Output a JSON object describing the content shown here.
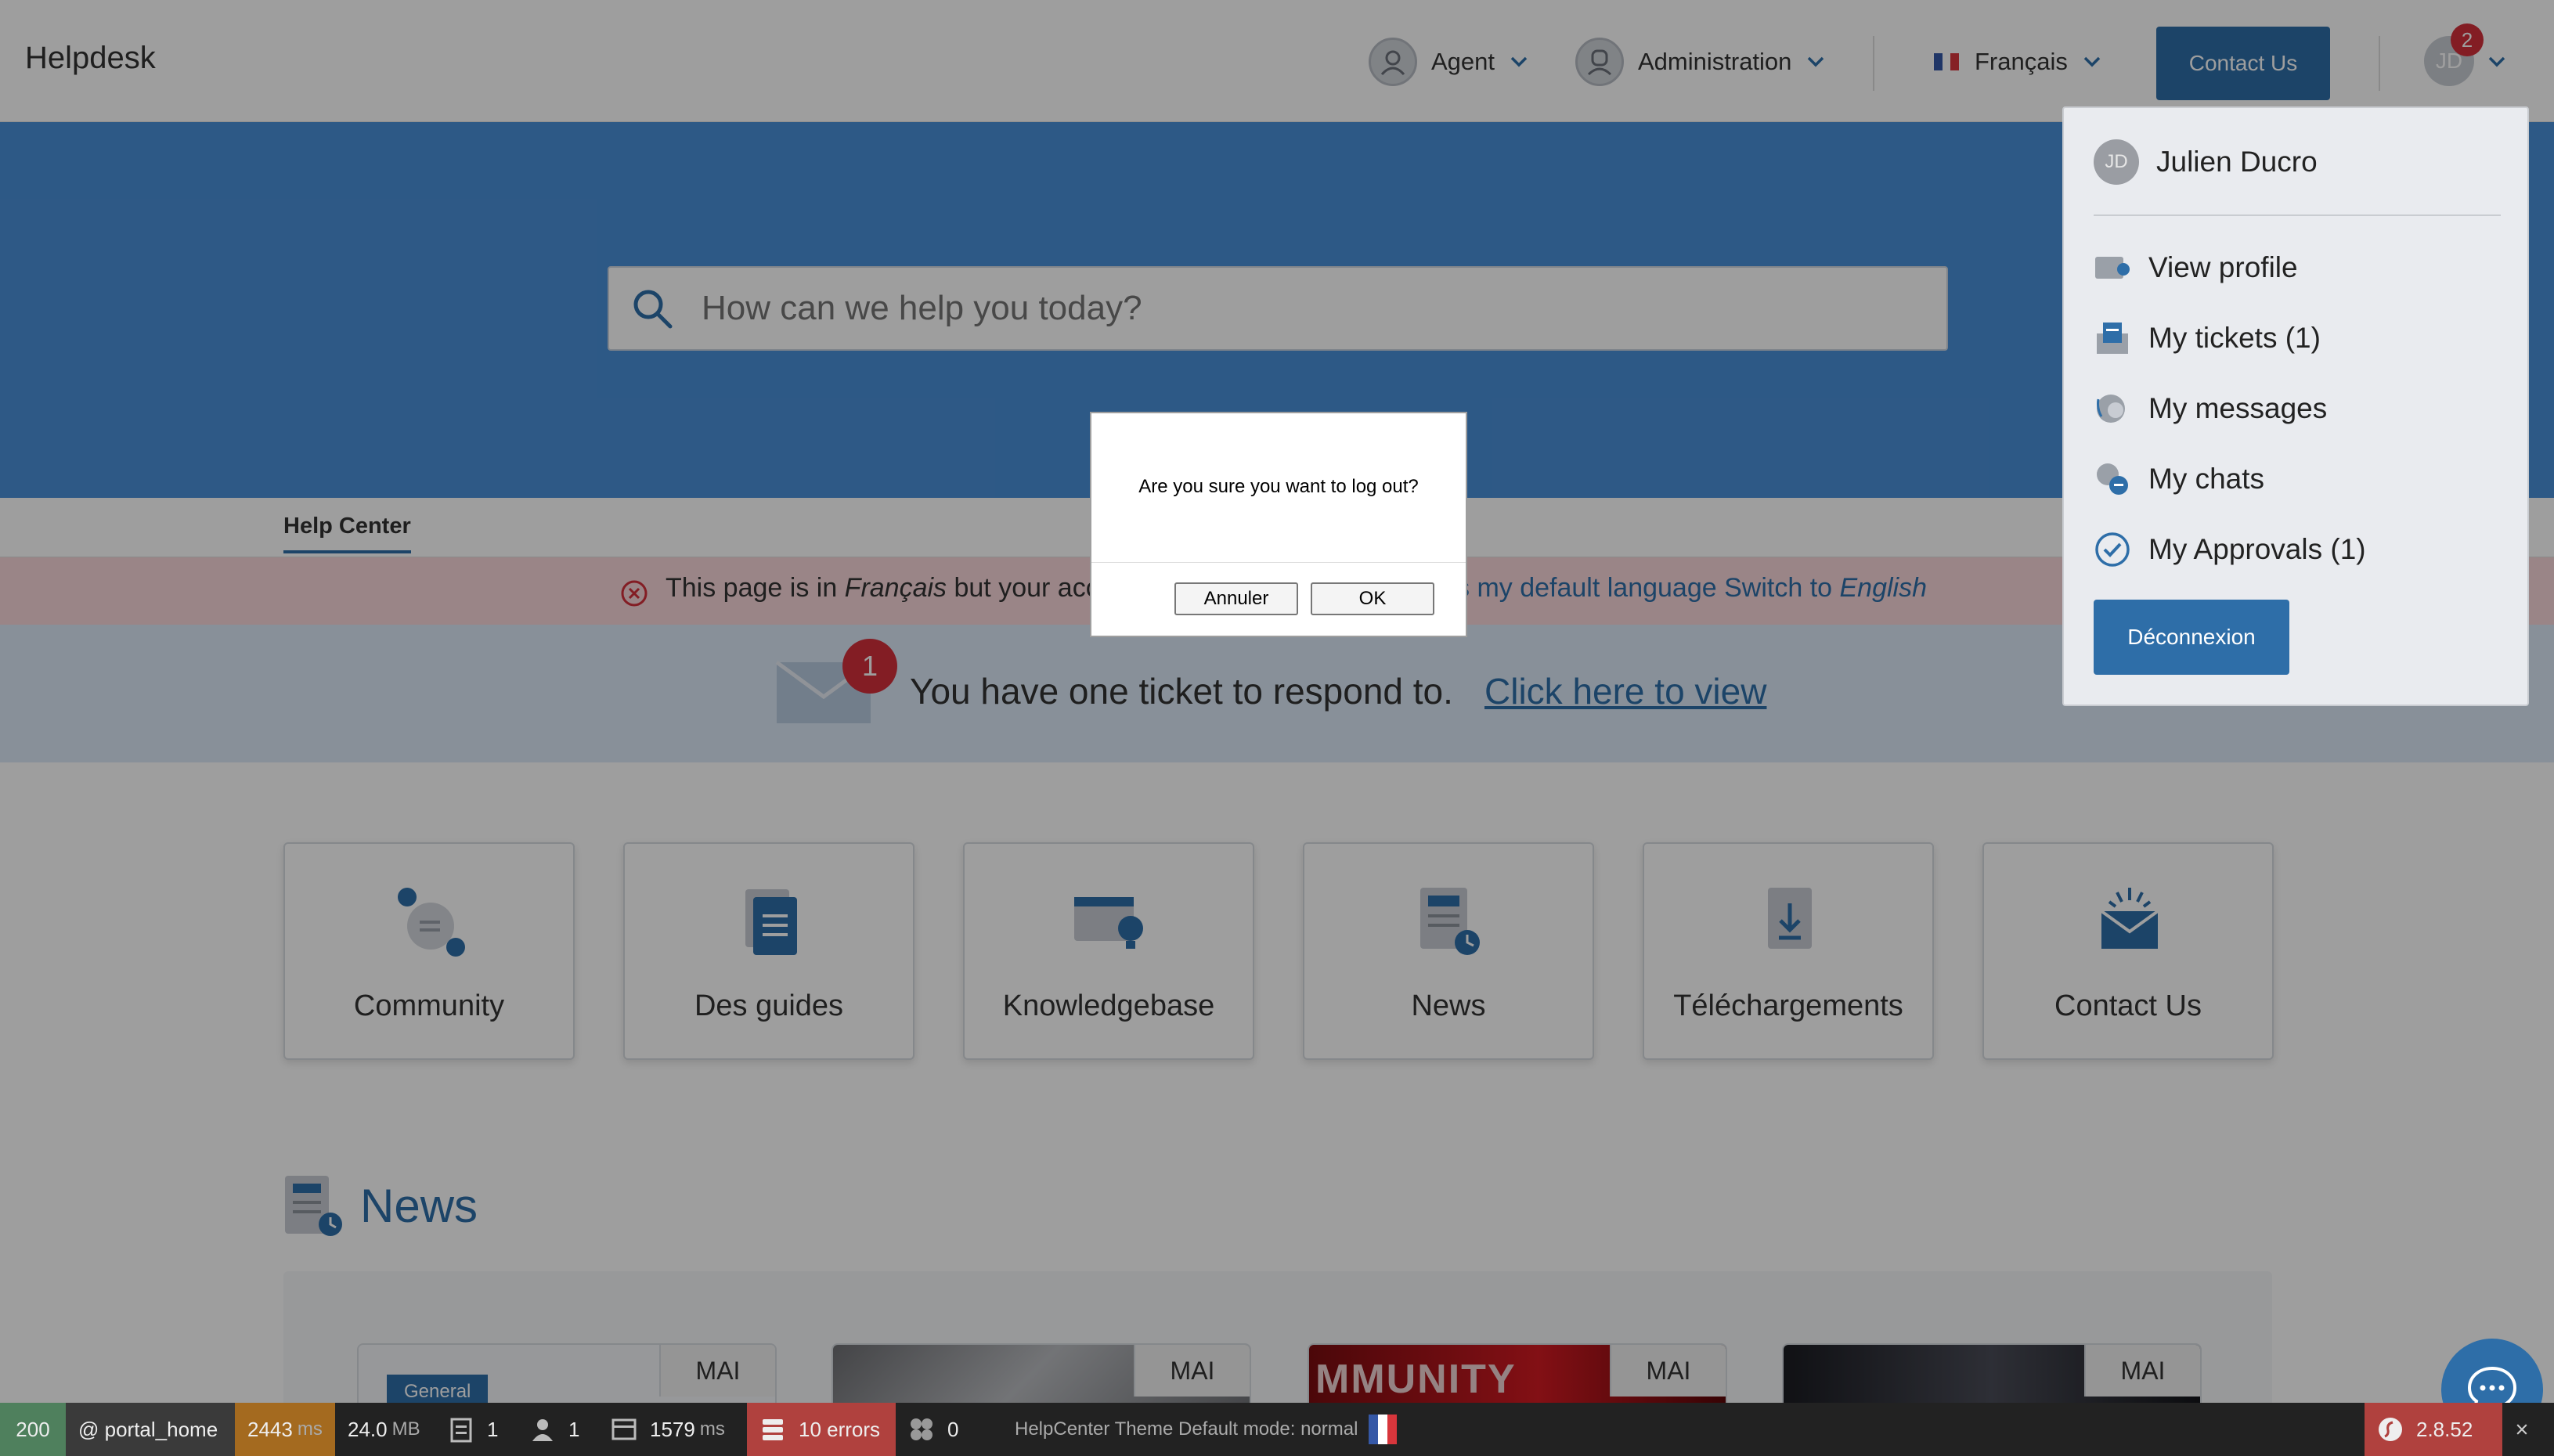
{
  "header": {
    "brand": "Helpdesk",
    "nav": [
      {
        "label": "Agent",
        "icon": "agent-avatar-icon"
      },
      {
        "label": "Administration",
        "icon": "admin-avatar-icon"
      }
    ],
    "language": {
      "label": "Français",
      "icon": "flag-fr-icon"
    },
    "contact_label": "Contact Us",
    "user_initials": "JD",
    "notification_count": "2"
  },
  "search": {
    "placeholder": "How can we help you today?"
  },
  "tabs": [
    {
      "label": "Help Center",
      "active": true
    }
  ],
  "language_warning": {
    "text_prefix": "This page is in ",
    "lang_current": "Français",
    "text_visible": " but your acc",
    "link_text": "s my default language Switch to ",
    "lang_target": "English"
  },
  "ticket_notice": {
    "badge": "1",
    "text": "You have one ticket to respond to.",
    "link": "Click here to view"
  },
  "categories": [
    {
      "label": "Community",
      "icon": "community-icon"
    },
    {
      "label": "Des guides",
      "icon": "guides-icon"
    },
    {
      "label": "Knowledgebase",
      "icon": "knowledgebase-icon"
    },
    {
      "label": "News",
      "icon": "news-icon"
    },
    {
      "label": "Téléchargements",
      "icon": "download-icon"
    },
    {
      "label": "Contact Us",
      "icon": "contact-mail-icon"
    }
  ],
  "news": {
    "title": "News",
    "cards": [
      {
        "date": "MAI",
        "tag": "General"
      },
      {
        "date": "MAI",
        "tag": ""
      },
      {
        "date": "MAI",
        "tag": "",
        "image_text": "MMUNITY"
      },
      {
        "date": "MAI",
        "tag": ""
      }
    ]
  },
  "user_menu": {
    "initials": "JD",
    "name": "Julien Ducro",
    "items": [
      {
        "label": "View profile",
        "icon": "profile-settings-icon"
      },
      {
        "label": "My tickets (1)",
        "icon": "tickets-icon"
      },
      {
        "label": "My messages",
        "icon": "messages-icon"
      },
      {
        "label": "My chats",
        "icon": "chats-icon"
      },
      {
        "label": "My Approvals (1)",
        "icon": "approval-check-icon"
      }
    ],
    "logout_label": "Déconnexion"
  },
  "dialog": {
    "message": "Are you sure you want to log out?",
    "cancel_label": "Annuler",
    "ok_label": "OK"
  },
  "toolbar": {
    "status": "200",
    "route": "@ portal_home",
    "time": "2443",
    "time_unit": "ms",
    "memory": "24.0",
    "memory_unit": "MB",
    "forms": "1",
    "user": "1",
    "db_time": "1579",
    "db_unit": "ms",
    "errors": "10 errors",
    "events": "0",
    "theme": "HelpCenter Theme Default mode: normal",
    "version": "2.8.52"
  },
  "colors": {
    "primary": "#2e6ea8",
    "hero": "#4a90d9",
    "badge": "#d32f3b",
    "warning_bg": "#f8d7da",
    "notice_bg": "#dbe9f7",
    "toolbar_bg": "#222222",
    "toolbar_status": "#4f805d",
    "toolbar_time": "#a46a1f",
    "toolbar_errors": "#b0413e"
  }
}
